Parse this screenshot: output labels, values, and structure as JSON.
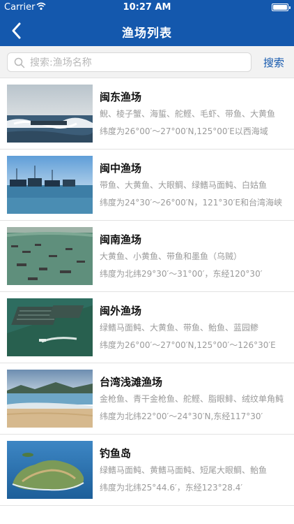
{
  "status_bar": {
    "carrier": "Carrier",
    "time": "10:27 AM"
  },
  "nav": {
    "title": "渔场列表"
  },
  "search": {
    "placeholder": "搜索:渔场名称",
    "button_label": "搜索"
  },
  "fisheries": [
    {
      "name": "闽东渔场",
      "species": "鲵、棱子蟹、海蜇、舵鲣、毛虾、带鱼、大黄鱼",
      "range": "纬度为26°00′～27°00′N,125°00′E以西海域"
    },
    {
      "name": "闽中渔场",
      "species": "带鱼、大黄鱼、大眼鲷、绿鳍马面鲀、白姑鱼",
      "range": "纬度为24°30′～26°00′N，121°30′E和台湾海峡"
    },
    {
      "name": "闽南渔场",
      "species": "大黄鱼、小黄鱼、带鱼和墨鱼（乌贼）",
      "range": "纬度为北纬29°30′～31°00′，东经120°30′"
    },
    {
      "name": "闽外渔场",
      "species": "绿鳍马面鲀、大黄鱼、带鱼、鲐鱼、蓝园鲹",
      "range": "纬度为26°00′～27°00′N,125°00′～126°30′E"
    },
    {
      "name": "台湾浅滩渔场",
      "species": "金枪鱼、青干金枪鱼、舵鲣、脂眼鲱、绒纹单角鲀",
      "range": "纬度为北纬22°00′～24°30′N,东经117°30′"
    },
    {
      "name": "钓鱼岛",
      "species": "绿鳍马面鲀、黄鳍马面鲀、短尾大眼鲷、鲐鱼",
      "range": "纬度为北纬25°44.6′，东经123°28.4′"
    }
  ]
}
